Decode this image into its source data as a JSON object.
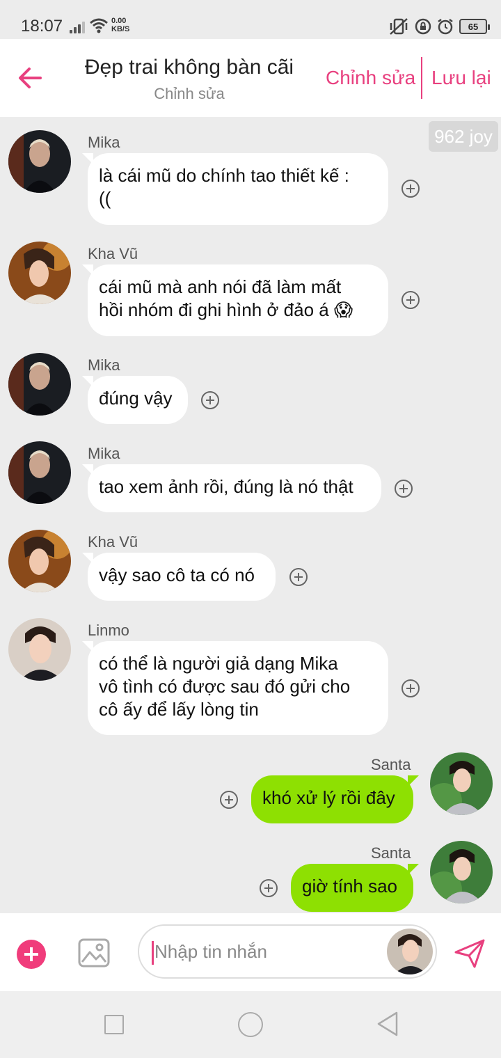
{
  "status_bar": {
    "time": "18:07",
    "net_speed_value": "0.00",
    "net_speed_unit": "KB/S",
    "battery": "65"
  },
  "header": {
    "title": "Đẹp trai không bàn cãi",
    "subtitle": "Chỉnh sửa",
    "edit_label": "Chỉnh sửa",
    "save_label": "Lưu lại"
  },
  "watermark": "962 joy",
  "messages": [
    {
      "sender": "Mika",
      "lines": [
        "là cái mũ do chính tao thiết kế :",
        "(("
      ]
    },
    {
      "sender": "Kha Vũ",
      "lines": [
        "cái mũ mà anh nói đã làm mất",
        "hồi nhóm đi ghi hình ở đảo á 😱"
      ]
    },
    {
      "sender": "Mika",
      "lines": [
        "đúng vậy"
      ]
    },
    {
      "sender": "Mika",
      "lines": [
        "tao xem ảnh rồi, đúng là nó thật"
      ]
    },
    {
      "sender": "Kha Vũ",
      "lines": [
        "vậy sao cô ta có nó"
      ]
    },
    {
      "sender": "Linmo",
      "lines": [
        "có thể là người giả dạng Mika",
        "vô tình có được sau đó gửi cho",
        "cô ấy để lấy lòng tin"
      ]
    },
    {
      "sender": "Santa",
      "lines": [
        "khó xử lý rồi đây"
      ]
    },
    {
      "sender": "Santa",
      "lines": [
        "giờ tính sao"
      ]
    }
  ],
  "input": {
    "placeholder": "Nhập tin nhắn"
  },
  "colors": {
    "accent": "#e8407f",
    "outgoing_bubble": "#8ee002",
    "incoming_bubble": "#ffffff",
    "background": "#ececec"
  }
}
